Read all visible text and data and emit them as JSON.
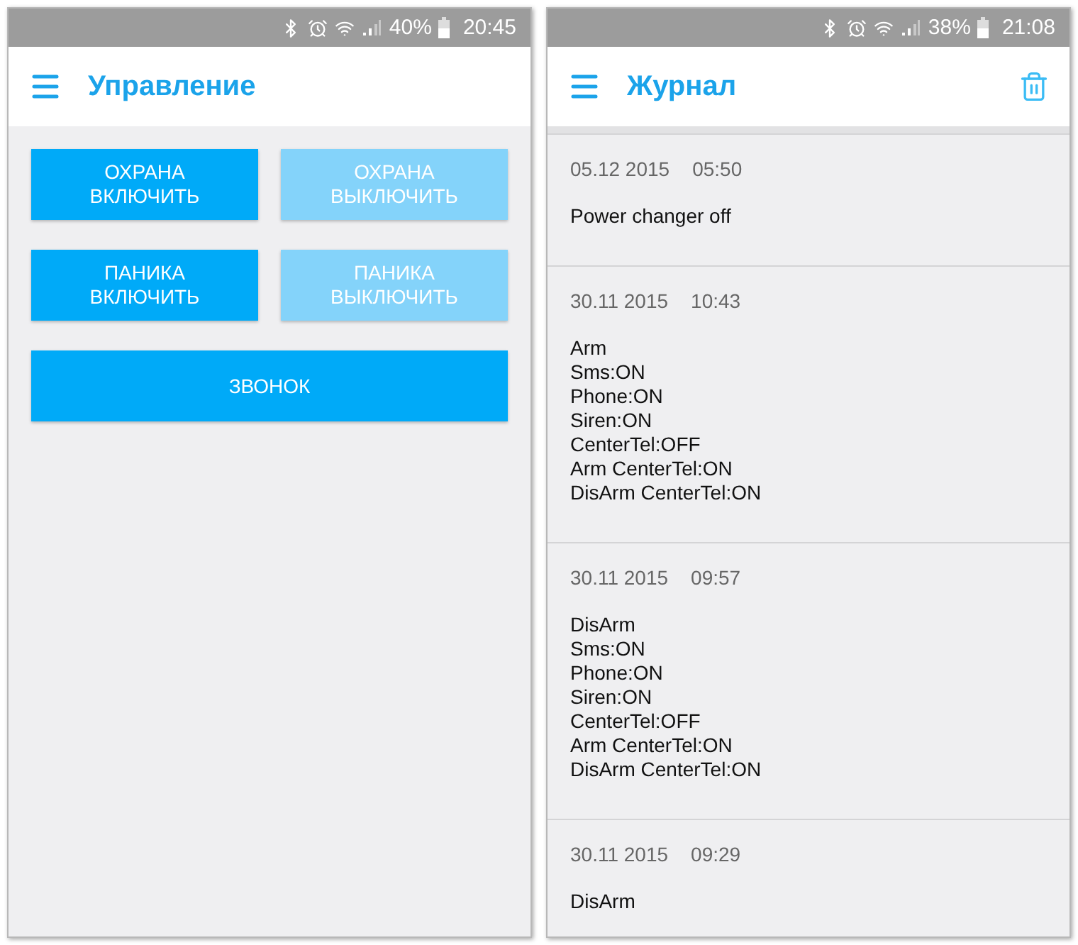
{
  "screens": [
    {
      "kind": "control",
      "status_bar": {
        "battery": "40%",
        "time": "20:45"
      },
      "app_bar": {
        "title": "Управление"
      },
      "button_rows": [
        {
          "buttons": [
            {
              "label": "ОХРАНА\nВКЛЮЧИТЬ",
              "disabled": false
            },
            {
              "label": "ОХРАНА\nВЫКЛЮЧИТЬ",
              "disabled": true
            }
          ]
        },
        {
          "buttons": [
            {
              "label": "ПАНИКА\nВКЛЮЧИТЬ",
              "disabled": false
            },
            {
              "label": "ПАНИКА\nВЫКЛЮЧИТЬ",
              "disabled": true
            }
          ]
        },
        {
          "buttons": [
            {
              "label": "ЗВОНОК",
              "disabled": false
            }
          ]
        }
      ]
    },
    {
      "kind": "log",
      "status_bar": {
        "battery": "38%",
        "time": "21:08"
      },
      "app_bar": {
        "title": "Журнал"
      },
      "entries": [
        {
          "date": "05.12 2015",
          "time": "05:50",
          "lines": [
            "Power changer off"
          ]
        },
        {
          "date": "30.11 2015",
          "time": "10:43",
          "lines": [
            "Arm",
            "Sms:ON",
            "Phone:ON",
            "Siren:ON",
            "CenterTel:OFF",
            "Arm CenterTel:ON",
            "DisArm CenterTel:ON"
          ]
        },
        {
          "date": "30.11 2015",
          "time": "09:57",
          "lines": [
            "DisArm",
            "Sms:ON",
            "Phone:ON",
            "Siren:ON",
            "CenterTel:OFF",
            "Arm CenterTel:ON",
            "DisArm CenterTel:ON"
          ]
        },
        {
          "date": "30.11 2015",
          "time": "09:29",
          "lines": [
            "DisArm"
          ]
        }
      ]
    }
  ]
}
